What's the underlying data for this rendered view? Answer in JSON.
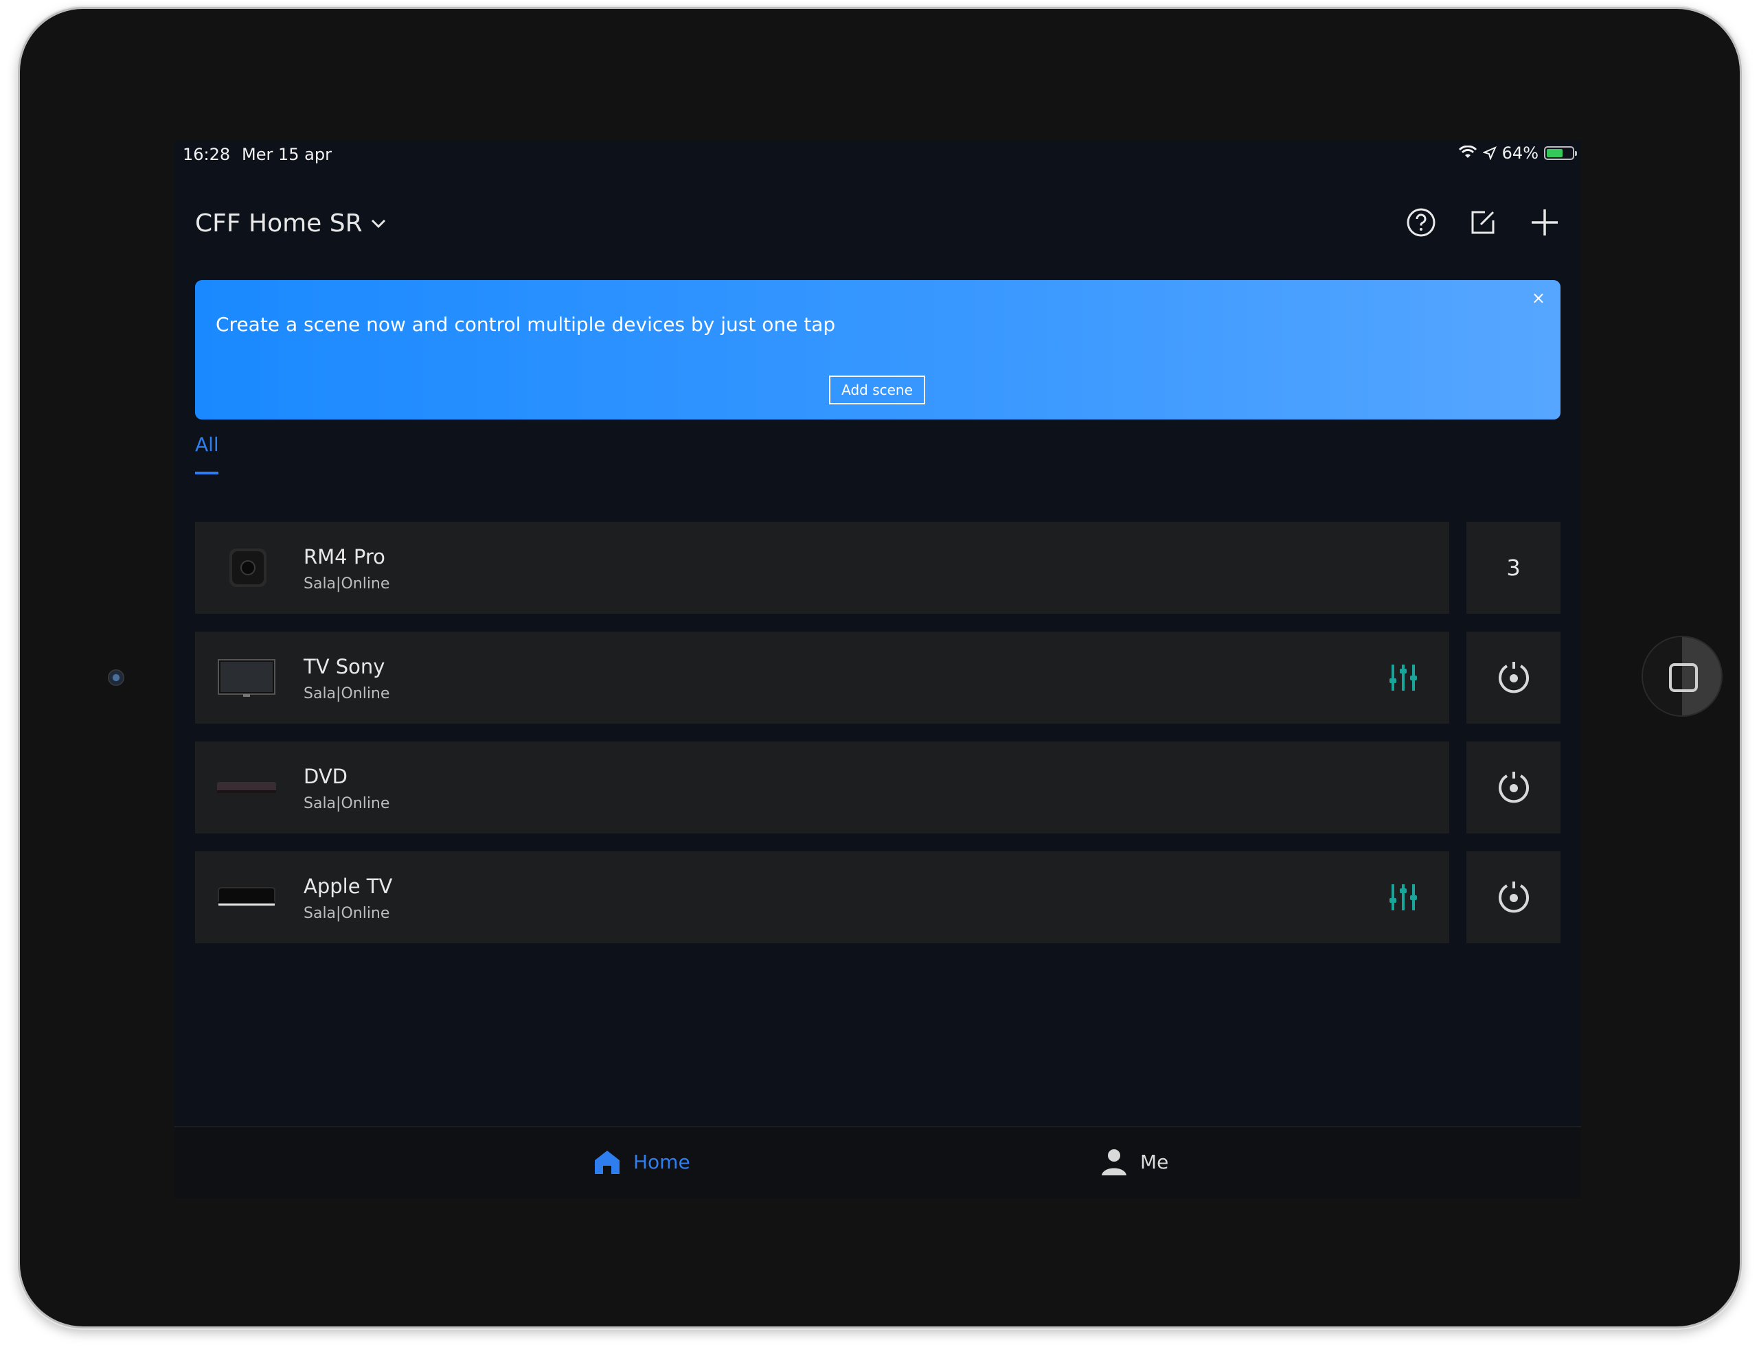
{
  "status_bar": {
    "time": "16:28",
    "date": "Mer 15 apr",
    "battery": "64%",
    "battery_level": 0.64,
    "icons": [
      "wifi-icon",
      "location-arrow-icon",
      "battery-charging-icon"
    ]
  },
  "header": {
    "home_name": "CFF Home SR",
    "icons": [
      "help-icon",
      "edit-icon",
      "add-icon"
    ]
  },
  "banner": {
    "message": "Create a scene now and control multiple devices by just one tap",
    "button_label": "Add scene",
    "close_label": "×"
  },
  "tabs": [
    {
      "label": "All",
      "active": true
    }
  ],
  "devices": [
    {
      "name": "RM4 Pro",
      "subtitle": "Sala|Online",
      "icon": "hub-icon",
      "side": "3",
      "has_remote": false
    },
    {
      "name": "TV Sony",
      "subtitle": "Sala|Online",
      "icon": "tv-icon",
      "side": "power-icon",
      "has_remote": true
    },
    {
      "name": "DVD",
      "subtitle": "Sala|Online",
      "icon": "dvd-player-icon",
      "side": "power-icon",
      "has_remote": false
    },
    {
      "name": "Apple TV",
      "subtitle": "Sala|Online",
      "icon": "apple-tv-icon",
      "side": "power-icon",
      "has_remote": true
    }
  ],
  "bottom_nav": {
    "home_label": "Home",
    "me_label": "Me"
  },
  "colors": {
    "accent": "#2f7ef0",
    "remote_icon": "#1aa59a",
    "banner_gradient": [
      "#1a89ff",
      "#56a6ff"
    ],
    "background": "#0c111a",
    "card": "#1d1e20"
  }
}
